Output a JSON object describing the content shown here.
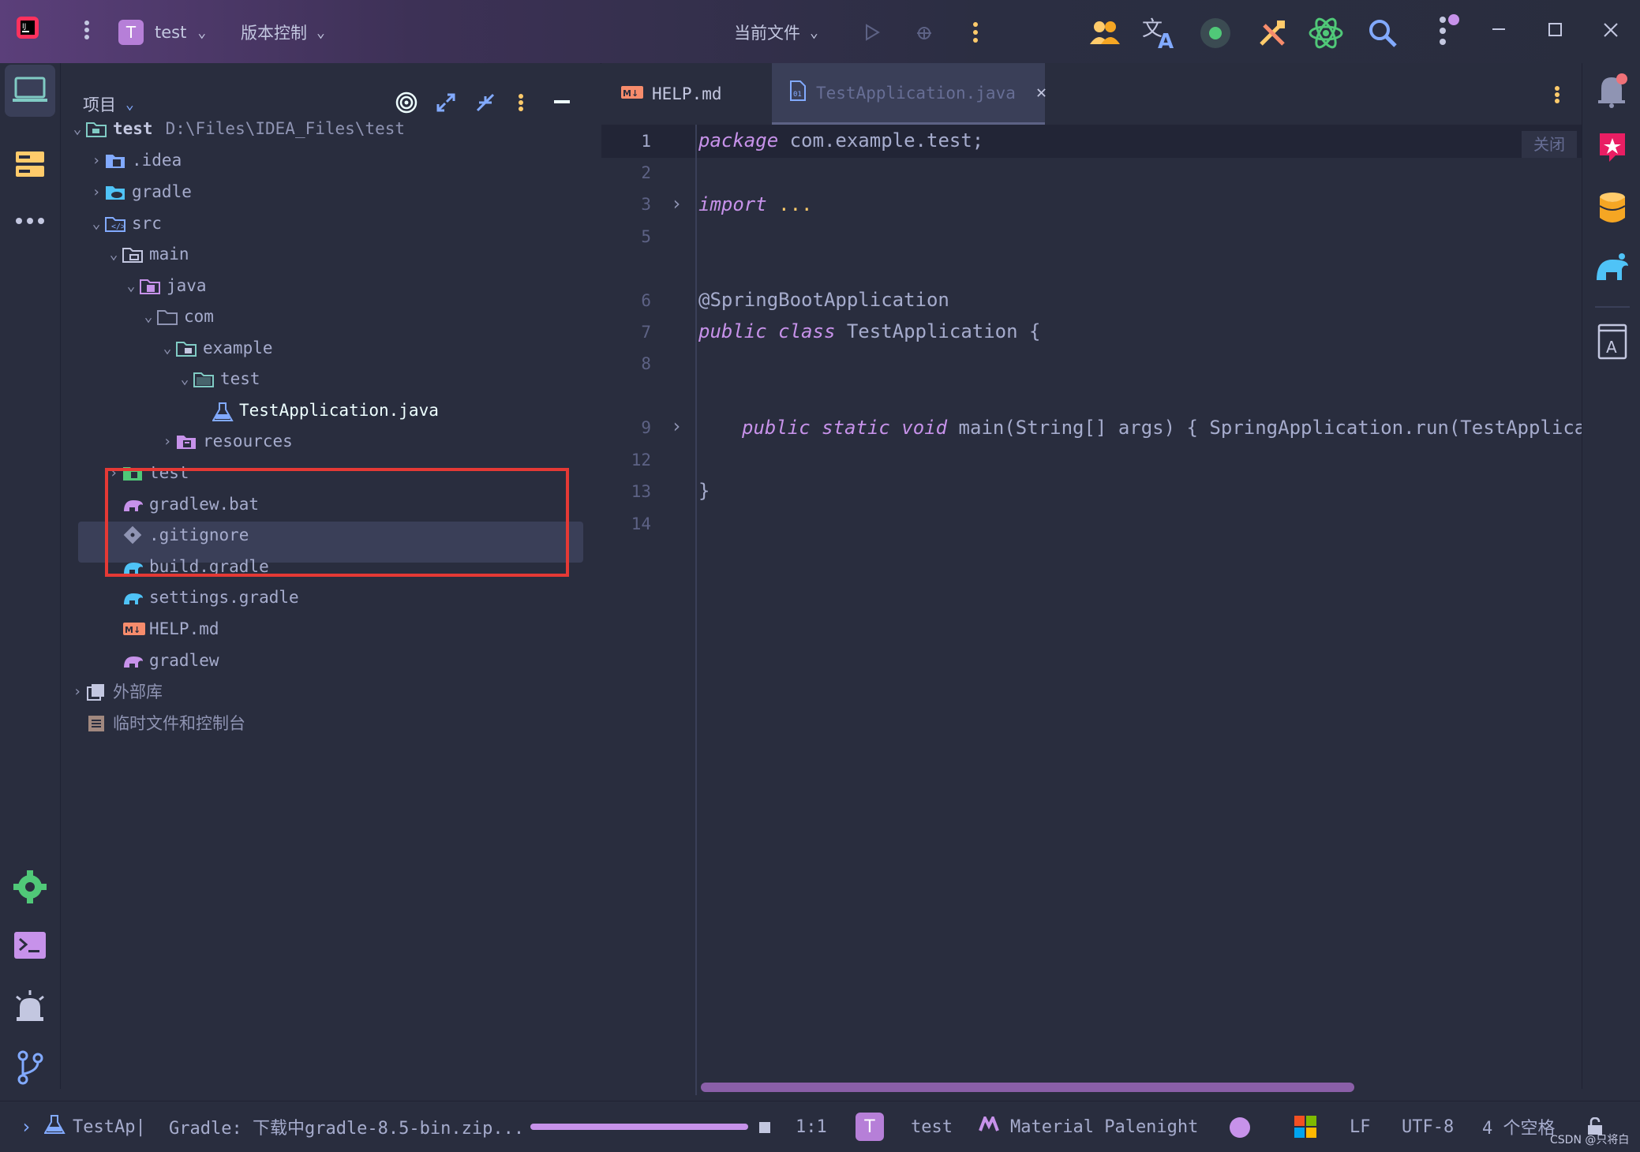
{
  "titlebar": {
    "project_badge": "T",
    "project_name": "test",
    "vcs_label": "版本控制",
    "run_config": "当前文件"
  },
  "project_panel": {
    "title": "项目",
    "root_name": "test",
    "root_path": "D:\\Files\\IDEA_Files\\test",
    "items": [
      {
        "label": ".idea"
      },
      {
        "label": "gradle"
      },
      {
        "label": "src"
      },
      {
        "label": "main"
      },
      {
        "label": "java"
      },
      {
        "label": "com"
      },
      {
        "label": "example"
      },
      {
        "label": "test"
      },
      {
        "label": "TestApplication.java"
      },
      {
        "label": "resources"
      },
      {
        "label": "test"
      },
      {
        "label": "gradlew.bat"
      },
      {
        "label": ".gitignore"
      },
      {
        "label": "build.gradle"
      },
      {
        "label": "settings.gradle"
      },
      {
        "label": "HELP.md"
      },
      {
        "label": "gradlew"
      },
      {
        "label": "外部库"
      },
      {
        "label": "临时文件和控制台"
      }
    ]
  },
  "editor": {
    "tabs": [
      {
        "label": "HELP.md",
        "icon": "markdown-icon"
      },
      {
        "label": "TestApplication.java",
        "icon": "java-class-icon",
        "active": true
      }
    ],
    "close_hint": "关闭",
    "line_numbers": [
      "1",
      "2",
      "3",
      "5",
      "6",
      "7",
      "8",
      "9",
      "12",
      "13",
      "14"
    ],
    "code": {
      "l1_kw": "package",
      "l1_rest": " com.example.test;",
      "l3_kw": "import",
      "l3_rest": " ...",
      "l6": "@SpringBootApplication",
      "l7_kw": "public class",
      "l7_rest": " TestApplication {",
      "l9_kw": "public static void",
      "l9_rest": " main(String[] args) { SpringApplication.run(TestApplicati",
      "l13": "}"
    }
  },
  "statusbar": {
    "run_label": "TestAp|",
    "gradle_task": "Gradle: 下载中gradle-8.5-bin.zip...",
    "progress": 1.0,
    "caret_pos": "1:1",
    "project_badge": "T",
    "project_name": "test",
    "theme_name": "Material Palenight",
    "line_sep": "LF",
    "encoding": "UTF-8",
    "indent": "4 个空格",
    "watermark": "CSDN @只将白"
  },
  "colors": {
    "background": "#292d3e",
    "highlight": "#e53935",
    "accent": "#c792ea",
    "selection": "#3a3f58"
  }
}
